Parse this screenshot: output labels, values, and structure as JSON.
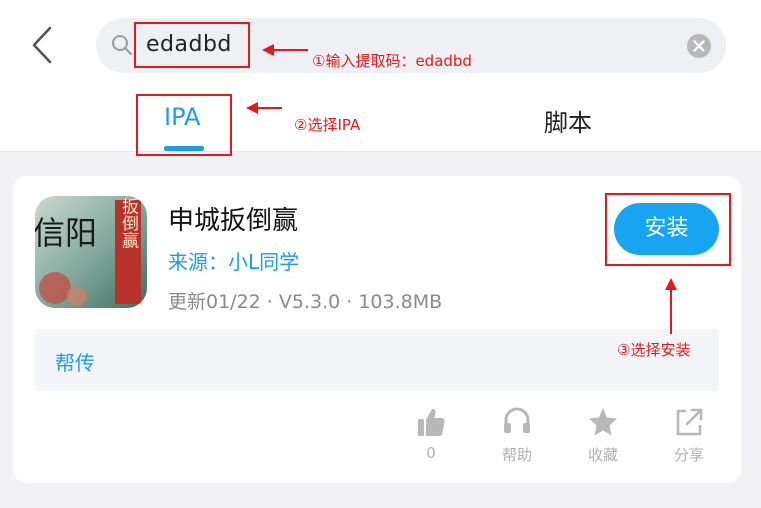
{
  "search": {
    "value": "edadbd"
  },
  "tabs": [
    {
      "label": "IPA",
      "active": true
    },
    {
      "label": "脚本",
      "active": false
    }
  ],
  "app": {
    "name": "申城扳倒赢",
    "icon_text_large": "信阳",
    "icon_text_banner": "申城扳倒赢",
    "source": "来源：小L同学",
    "meta": "更新01/22 · V5.3.0 · 103.8MB",
    "install_label": "安装",
    "description": "帮传"
  },
  "actions": [
    {
      "icon": "thumbs-up-icon",
      "label": "0"
    },
    {
      "icon": "headset-icon",
      "label": "帮助"
    },
    {
      "icon": "star-icon",
      "label": "收藏"
    },
    {
      "icon": "share-icon",
      "label": "分享"
    }
  ],
  "annotations": {
    "step1": "①输入提取码：edadbd",
    "step2": "②选择IPA",
    "step3": "③选择安装"
  },
  "colors": {
    "accent": "#1e9bf0",
    "install_button": "#17a5f2",
    "annotation": "#e11b1b"
  }
}
